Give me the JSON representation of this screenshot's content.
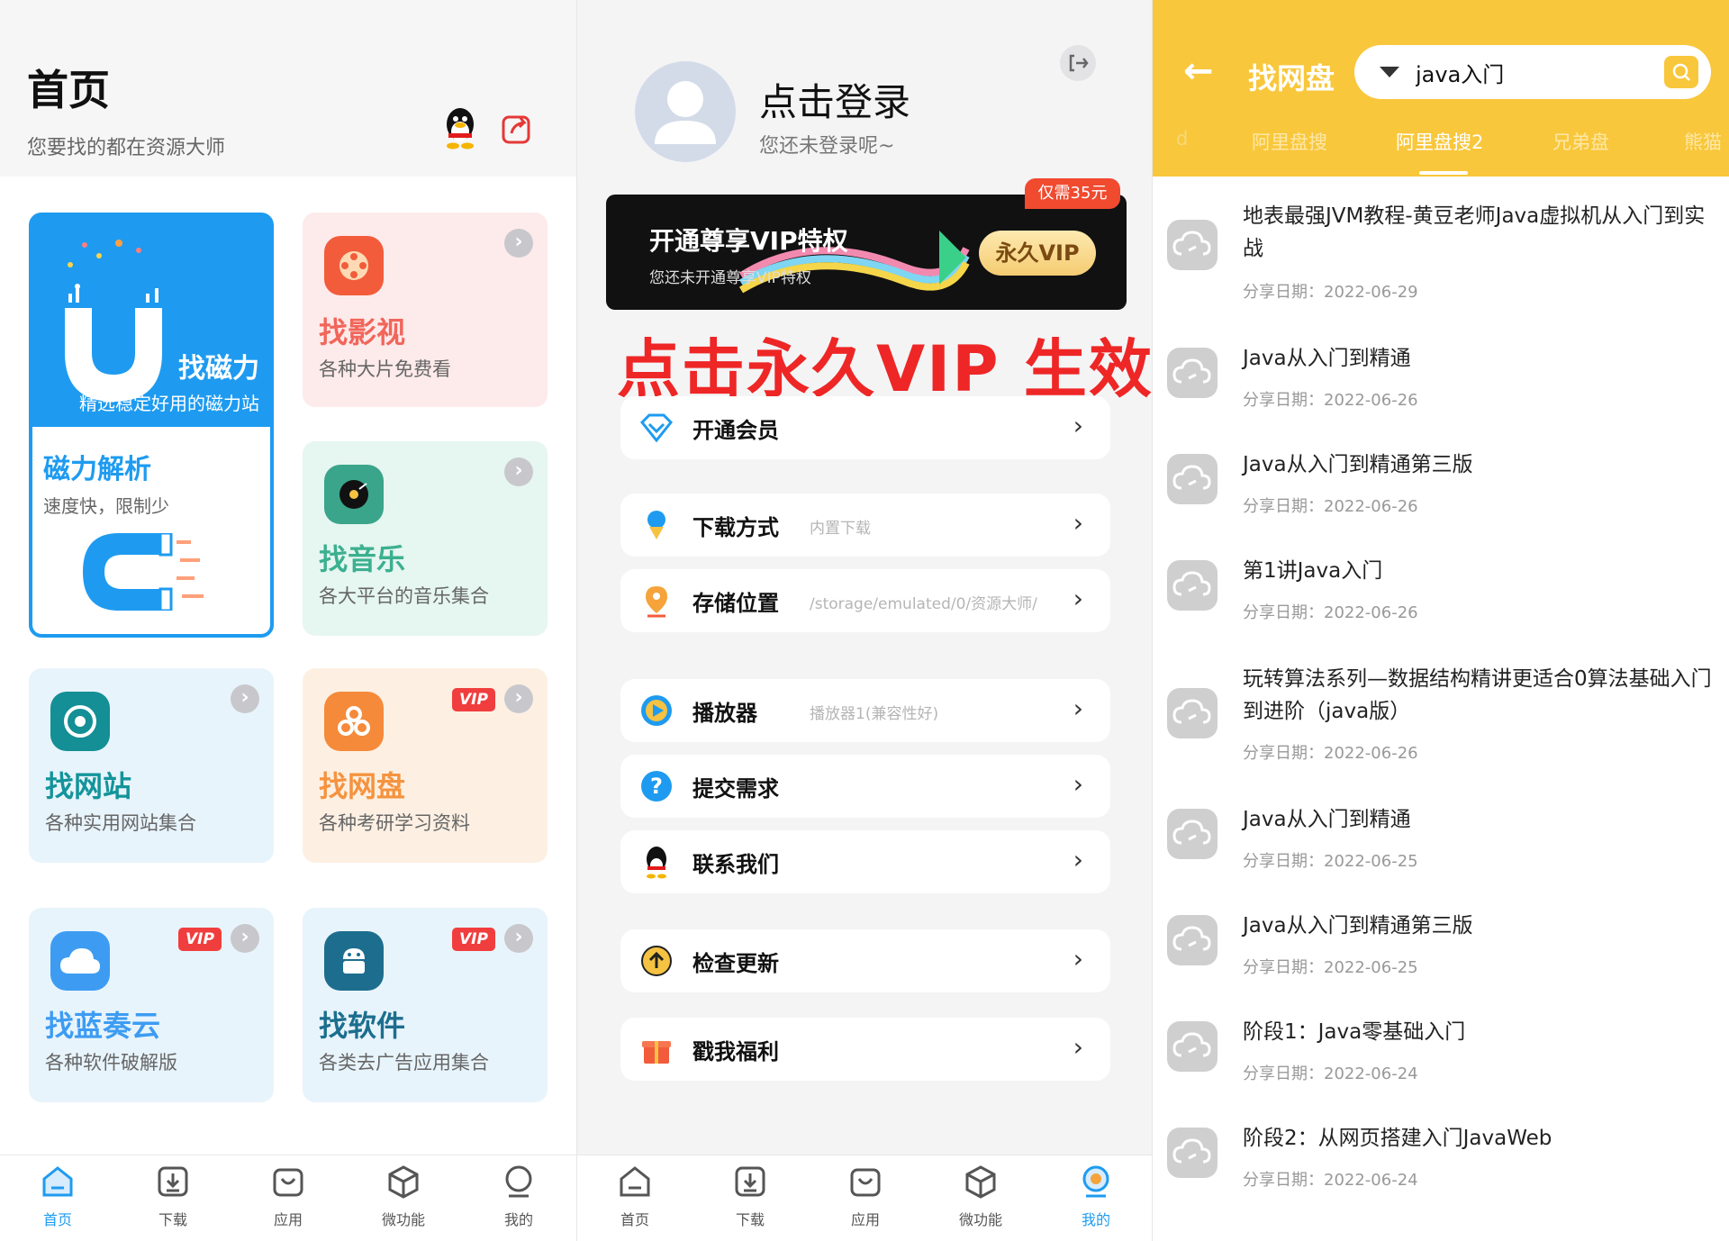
{
  "panel_home": {
    "title": "首页",
    "subtitle": "您要找的都在资源大师",
    "magnet_card": {
      "title": "找磁力",
      "subtitle": "精选稳定好用的磁力站",
      "section_title": "磁力解析",
      "section_sub": "速度快，限制少"
    },
    "cards": [
      {
        "title": "找影视",
        "subtitle": "各种大片免费看",
        "vip": false
      },
      {
        "title": "找音乐",
        "subtitle": "各大平台的音乐集合",
        "vip": false
      },
      {
        "title": "找网站",
        "subtitle": "各种实用网站集合",
        "vip": false
      },
      {
        "title": "找网盘",
        "subtitle": "各种考研学习资料",
        "vip": true
      },
      {
        "title": "找蓝奏云",
        "subtitle": "各种软件破解版",
        "vip": true
      },
      {
        "title": "找软件",
        "subtitle": "各类去广告应用集合",
        "vip": true
      }
    ],
    "vip_badge": "VIP",
    "tabs": [
      "首页",
      "下载",
      "应用",
      "微功能",
      "我的"
    ],
    "active_tab": "首页"
  },
  "panel_me": {
    "login_title": "点击登录",
    "login_sub": "您还未登录呢~",
    "banner_title": "开通尊享VIP特权",
    "banner_sub": "您还未开通尊享VIP特权",
    "price_tag": "仅需35元",
    "vip_button": "永久VIP",
    "overlay_text": "点击永久VIP 生效",
    "rows": [
      {
        "label": "开通会员",
        "value": ""
      },
      {
        "label": "下载方式",
        "value": "内置下载"
      },
      {
        "label": "存储位置",
        "value": "/storage/emulated/0/资源大师/"
      },
      {
        "label": "播放器",
        "value": "播放器1(兼容性好)"
      },
      {
        "label": "提交需求",
        "value": ""
      },
      {
        "label": "联系我们",
        "value": ""
      },
      {
        "label": "检查更新",
        "value": ""
      },
      {
        "label": "戳我福利",
        "value": ""
      }
    ],
    "tabs": [
      "首页",
      "下载",
      "应用",
      "微功能",
      "我的"
    ],
    "active_tab": "我的"
  },
  "panel_search": {
    "title": "找网盘",
    "query": "java入门",
    "tabs": [
      "d",
      "阿里盘搜",
      "阿里盘搜2",
      "兄弟盘",
      "熊猫"
    ],
    "active_tab": "阿里盘搜2",
    "date_prefix": "分享日期: ",
    "results": [
      {
        "title": "地表最强JVM教程-黄豆老师Java虚拟机从入门到实战",
        "date": "分享日期：2022-06-29"
      },
      {
        "title": "Java从入门到精通",
        "date": "分享日期：2022-06-26"
      },
      {
        "title": "Java从入门到精通第三版",
        "date": "分享日期：2022-06-26"
      },
      {
        "title": "第1讲Java入门",
        "date": "分享日期：2022-06-26"
      },
      {
        "title": "玩转算法系列—数据结构精讲更适合0算法基础入门到进阶（java版）",
        "date": "分享日期：2022-06-26"
      },
      {
        "title": "Java从入门到精通",
        "date": "分享日期：2022-06-25"
      },
      {
        "title": "Java从入门到精通第三版",
        "date": "分享日期：2022-06-25"
      },
      {
        "title": "阶段1：Java零基础入门",
        "date": "分享日期：2022-06-24"
      },
      {
        "title": "阶段2：从网页搭建入门JavaWeb",
        "date": "分享日期：2022-06-24"
      }
    ]
  },
  "colors": {
    "blue": "#1e9bf0",
    "yellow": "#f9c73c",
    "red": "#ee2626",
    "pink_card": "#fdeaea",
    "green_card": "#e6f6f1",
    "blue_card": "#e8f4fc",
    "orange_card": "#fdf0e3"
  }
}
